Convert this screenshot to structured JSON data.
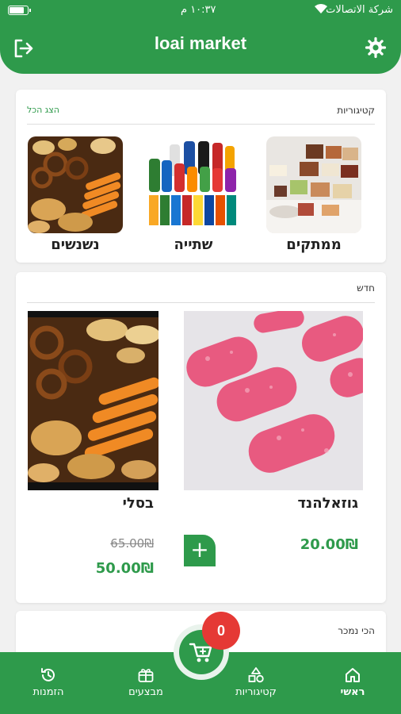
{
  "status_bar": {
    "carrier": "شركة الاتصالات",
    "time": "١٠:٣٧ م"
  },
  "header": {
    "title": "loai market"
  },
  "categories_section": {
    "title": "קטיגוריות",
    "show_all": "הצג הכל",
    "items": [
      {
        "label": "ממתקים"
      },
      {
        "label": "שתייה"
      },
      {
        "label": "נשנשים"
      }
    ]
  },
  "new_section": {
    "title": "חדש",
    "products": [
      {
        "name": "גוזאלהנד",
        "price": "20.00₪"
      },
      {
        "name": "בסלי",
        "old_price": "65.00₪",
        "price": "50.00₪"
      }
    ]
  },
  "best_section": {
    "title": "הכי נמכר"
  },
  "cart": {
    "count": "0"
  },
  "nav": {
    "items": [
      {
        "label": "ראשי"
      },
      {
        "label": "קטיגוריות"
      },
      {
        "label": "מבצעים"
      },
      {
        "label": "הזמנות"
      }
    ]
  },
  "colors": {
    "primary": "#2e9a4b",
    "badge": "#e53935",
    "background": "#f1f1f1"
  }
}
